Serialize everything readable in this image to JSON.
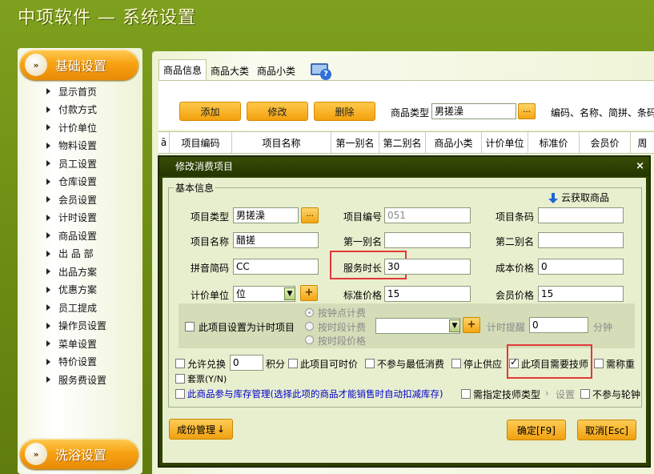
{
  "app": {
    "title": "中项软件 — 系统设置"
  },
  "sidebar": {
    "header_basic": "基础设置",
    "header_bath": "洗浴设置",
    "items": [
      "显示首页",
      "付款方式",
      "计价单位",
      "物料设置",
      "员工设置",
      "仓库设置",
      "会员设置",
      "计时设置",
      "商品设置",
      "出 品 部",
      "出品方案",
      "优惠方案",
      "员工提成",
      "操作员设置",
      "菜单设置",
      "特价设置",
      "服务费设置"
    ]
  },
  "tabs": [
    "商品信息",
    "商品大类",
    "商品小类"
  ],
  "toolbar": {
    "add": "添加",
    "edit": "修改",
    "delete": "删除",
    "type_label": "商品类型",
    "type_value": "男搓澡",
    "dots": "...",
    "search_hint": "编码、名称、简拼、条码"
  },
  "grid": {
    "columns": [
      "ā",
      "项目编码",
      "项目名称",
      "第一别名",
      "第二别名",
      "商品小类",
      "计价单位",
      "标准价",
      "会员价",
      "周"
    ]
  },
  "dialog": {
    "title": "修改消费项目",
    "close": "×",
    "group_title": "基本信息",
    "cloud_fetch": "云获取商品",
    "fields": {
      "item_type_label": "项目类型",
      "item_type_value": "男搓澡",
      "item_code_label": "项目编号",
      "item_code_value": "051",
      "item_barcode_label": "项目条码",
      "item_barcode_value": "",
      "item_name_label": "项目名称",
      "item_name_value": "醋搓",
      "alias1_label": "第一别名",
      "alias1_value": "",
      "alias2_label": "第二别名",
      "alias2_value": "",
      "pinyin_label": "拼音简码",
      "pinyin_value": "CC",
      "service_time_label": "服务时长",
      "service_time_value": "30",
      "cost_price_label": "成本价格",
      "cost_price_value": "0",
      "unit_label": "计价单位",
      "unit_value": "位",
      "std_price_label": "标准价格",
      "std_price_value": "15",
      "member_price_label": "会员价格",
      "member_price_value": "15"
    },
    "timer": {
      "set_timer_label": "此项目设置为计时项目",
      "by_clock": "按钟点计费",
      "by_period": "按时段计费",
      "by_period_price": "按时段价格",
      "remind_label": "计时提醒",
      "remind_value": "0",
      "minutes": "分钟"
    },
    "options": {
      "exchange": "允许兑换",
      "exchange_points": "0",
      "points": "积分",
      "time_price": "此项目可时价",
      "no_min": "不参与最低消费",
      "stop_supply": "停止供应",
      "need_tech": "此项目需要技师",
      "need_weigh": "需称重",
      "package": "套票(Y/N)",
      "inventory": "此商品参与库存管理(选择此项的商品才能销售时自动扣减库存)",
      "tech_type": "需指定技师类型",
      "setting": "设置",
      "no_rotation": "不参与轮钟"
    },
    "buttons": {
      "ingredients": "成份管理",
      "confirm": "确定[F9]",
      "cancel": "取消[Esc]"
    }
  }
}
